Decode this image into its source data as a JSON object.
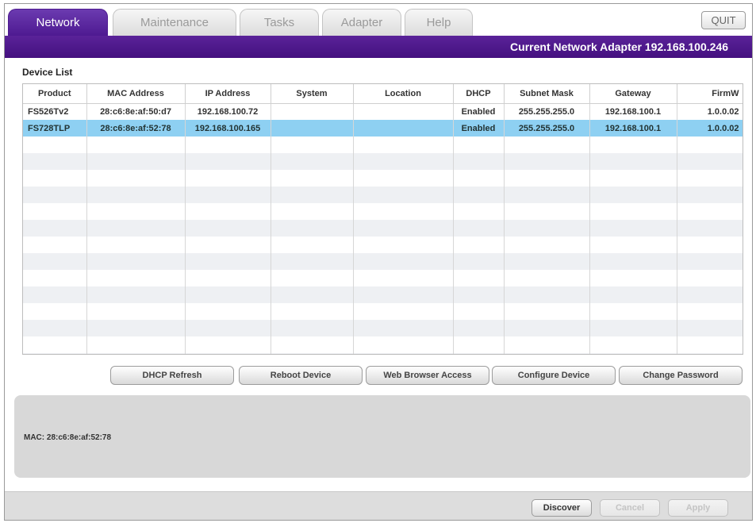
{
  "tabs": [
    {
      "label": "Network",
      "active": true
    },
    {
      "label": "Maintenance",
      "active": false
    },
    {
      "label": "Tasks",
      "active": false
    },
    {
      "label": "Adapter",
      "active": false
    },
    {
      "label": "Help",
      "active": false
    }
  ],
  "quit_label": "QUIT",
  "adapter_bar": {
    "text": "Current Network Adapter 192.168.100.246"
  },
  "device_list": {
    "title": "Device List",
    "columns": [
      "Product",
      "MAC Address",
      "IP Address",
      "System",
      "Location",
      "DHCP",
      "Subnet Mask",
      "Gateway",
      "FirmW"
    ],
    "rows": [
      {
        "product": "FS526Tv2",
        "mac": "28:c6:8e:af:50:d7",
        "ip": "192.168.100.72",
        "system": "",
        "location": "",
        "dhcp": "Enabled",
        "subnet": "255.255.255.0",
        "gateway": "192.168.100.1",
        "firmware": "1.0.0.02",
        "selected": false
      },
      {
        "product": "FS728TLP",
        "mac": "28:c6:8e:af:52:78",
        "ip": "192.168.100.165",
        "system": "",
        "location": "",
        "dhcp": "Enabled",
        "subnet": "255.255.255.0",
        "gateway": "192.168.100.1",
        "firmware": "1.0.0.02",
        "selected": true
      }
    ]
  },
  "actions": {
    "dhcp_refresh": "DHCP Refresh",
    "reboot_device": "Reboot Device",
    "web_browser_access": "Web Browser Access",
    "configure_device": "Configure Device",
    "change_password": "Change Password"
  },
  "info_panel": {
    "mac_text": "MAC: 28:c6:8e:af:52:78"
  },
  "bottom": {
    "discover": "Discover",
    "cancel": "Cancel",
    "apply": "Apply"
  },
  "colors": {
    "accent_purple": "#4e1a91",
    "selected_row": "#8ed0f2"
  }
}
